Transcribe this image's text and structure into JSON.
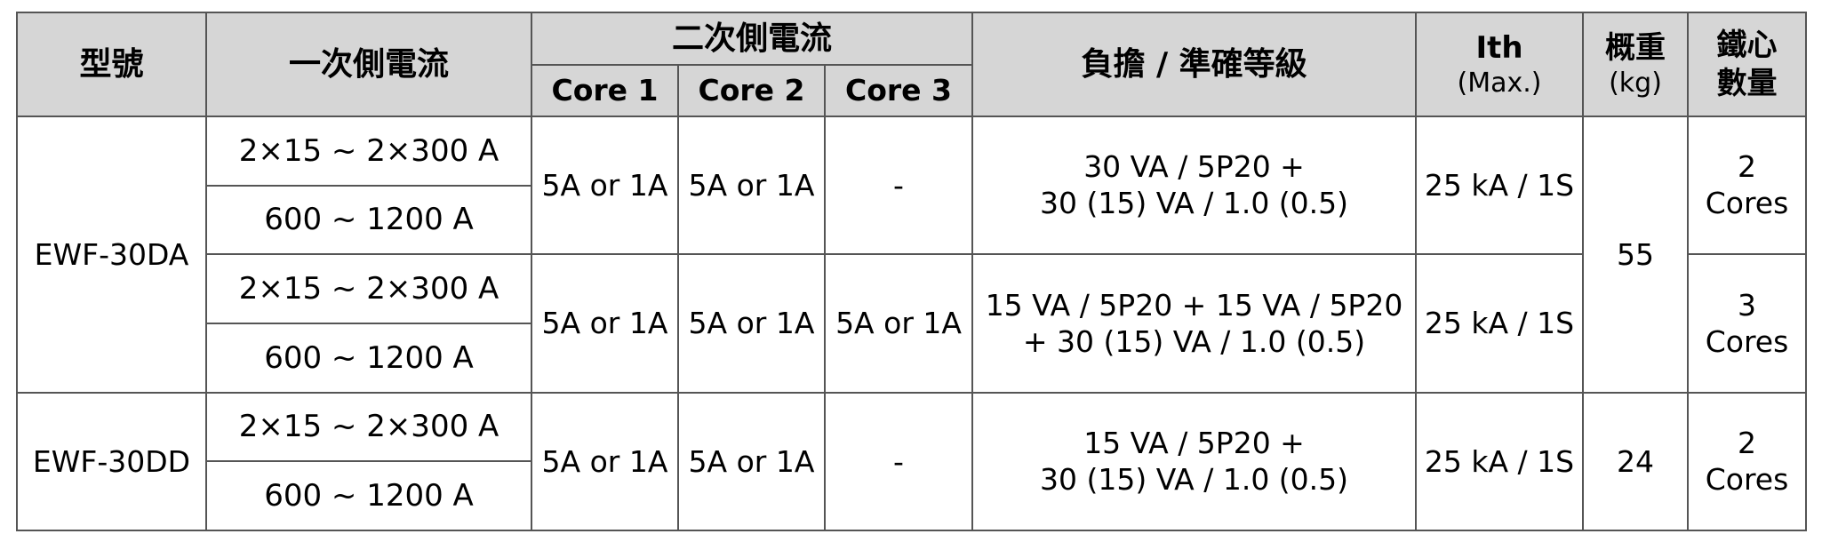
{
  "table": {
    "headers": {
      "model": "型號",
      "primary_current": "一次側電流",
      "secondary_current": "二次側電流",
      "cores": [
        "Core 1",
        "Core 2",
        "Core 3"
      ],
      "burden_accuracy": "負擔 / 準確等級",
      "ith": {
        "line1": "Ith",
        "line2": "(Max.)"
      },
      "weight": {
        "line1": "概重",
        "line2": "(kg)"
      },
      "core_count": {
        "line1": "鐵心",
        "line2": "數量"
      }
    },
    "models": [
      {
        "model": "EWF-30DA",
        "weight": "55",
        "groups": [
          {
            "primary": [
              "2×15 ~ 2×300 A",
              "600 ~ 1200 A"
            ],
            "core1": "5A or 1A",
            "core2": "5A or 1A",
            "core3": "-",
            "burden": [
              "30 VA / 5P20 +",
              "30 (15) VA / 1.0 (0.5)"
            ],
            "ith": "25 kA / 1S",
            "core_count": [
              "2",
              "Cores"
            ]
          },
          {
            "primary": [
              "2×15 ~ 2×300 A",
              "600 ~ 1200 A"
            ],
            "core1": "5A or 1A",
            "core2": "5A or 1A",
            "core3": "5A or 1A",
            "burden": [
              "15 VA / 5P20 + 15 VA / 5P20",
              "+ 30 (15) VA / 1.0 (0.5)"
            ],
            "ith": "25 kA / 1S",
            "core_count": [
              "3",
              "Cores"
            ]
          }
        ]
      },
      {
        "model": "EWF-30DD",
        "weight": "24",
        "groups": [
          {
            "primary": [
              "2×15 ~ 2×300 A",
              "600 ~ 1200 A"
            ],
            "core1": "5A or 1A",
            "core2": "5A or 1A",
            "core3": "-",
            "burden": [
              "15 VA / 5P20 +",
              "30 (15) VA / 1.0 (0.5)"
            ],
            "ith": "25 kA / 1S",
            "core_count": [
              "2",
              "Cores"
            ]
          }
        ]
      }
    ],
    "colors": {
      "header_bg": "#d6d6d6",
      "border": "#555555",
      "body_bg": "#ffffff",
      "text": "#000000"
    }
  }
}
